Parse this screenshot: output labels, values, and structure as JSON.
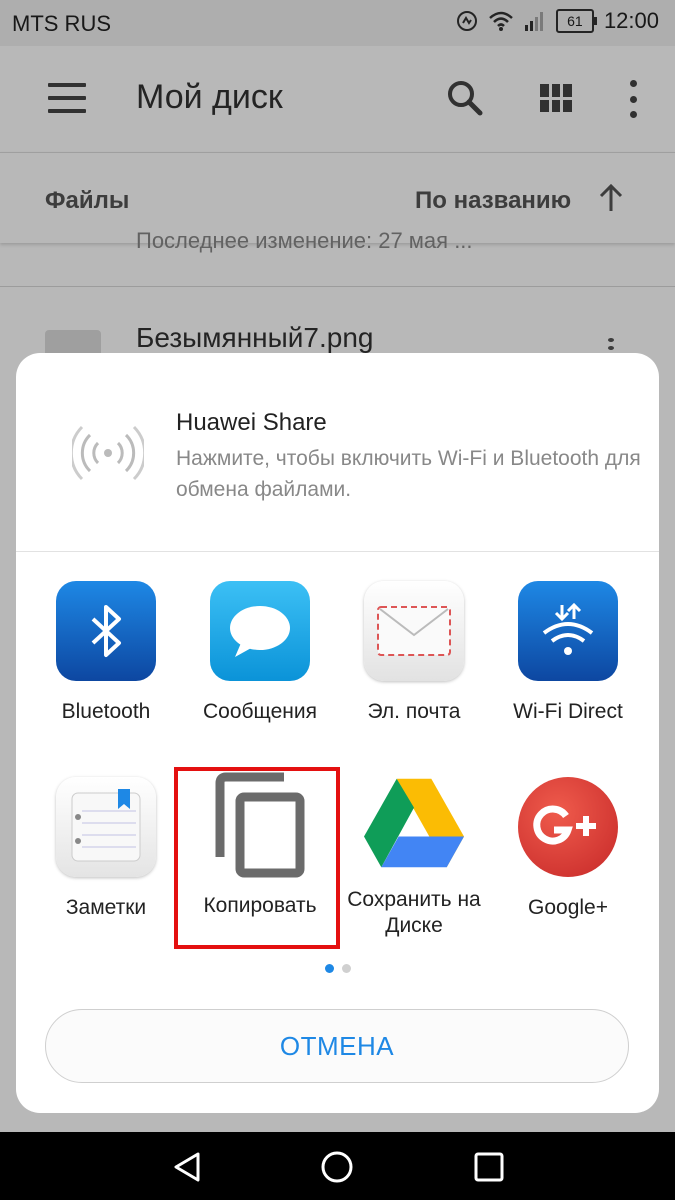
{
  "status_bar": {
    "carrier": "MTS RUS",
    "battery": "61",
    "time": "12:00"
  },
  "app_bar": {
    "title": "Мой диск"
  },
  "sort_bar": {
    "files_label": "Файлы",
    "sort_label": "По названию"
  },
  "file_list": {
    "partial_meta": "Последнее изменение: 27 мая ...",
    "item_name": "Безымянный7.png"
  },
  "huawei_share": {
    "title": "Huawei Share",
    "description": "Нажмите, чтобы включить Wi-Fi и Bluetooth для обмена файлами."
  },
  "apps": [
    {
      "label": "Bluetooth",
      "icon": "bluetooth-icon",
      "color": "#1565c0"
    },
    {
      "label": "Сообщения",
      "icon": "messages-icon",
      "color": "#1ea7e8"
    },
    {
      "label": "Эл. почта",
      "icon": "email-icon",
      "color": "#eeeeee"
    },
    {
      "label": "Wi-Fi Direct",
      "icon": "wifi-direct-icon",
      "color": "#1565c0"
    },
    {
      "label": "Заметки",
      "icon": "notes-icon",
      "color": "#eeeeee"
    },
    {
      "label": "Копировать",
      "icon": "copy-icon",
      "color": "#6b6b6b"
    },
    {
      "label": "Сохранить на Диске",
      "icon": "google-drive-icon",
      "color": "#0f9d58"
    },
    {
      "label": "Google+",
      "icon": "google-plus-icon",
      "color": "#db4437"
    }
  ],
  "pager": {
    "pages": 2,
    "current": 1
  },
  "cancel_button": {
    "label": "ОТМЕНА"
  },
  "colors": {
    "accent": "#1e88e5",
    "highlight": "#e41010"
  }
}
